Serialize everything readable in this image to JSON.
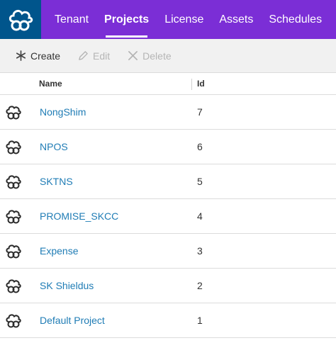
{
  "nav": {
    "logo_icon": "cloud-link-logo-icon",
    "tabs": [
      {
        "label": "Tenant",
        "active": false
      },
      {
        "label": "Projects",
        "active": true
      },
      {
        "label": "License",
        "active": false
      },
      {
        "label": "Assets",
        "active": false
      },
      {
        "label": "Schedules",
        "active": false
      }
    ],
    "colors": {
      "bar": "#7b2ed6",
      "logo_bg": "#00558c"
    }
  },
  "toolbar": {
    "create_label": "Create",
    "create_icon": "asterisk-icon",
    "edit_label": "Edit",
    "edit_icon": "pencil-icon",
    "delete_label": "Delete",
    "delete_icon": "x-icon"
  },
  "table": {
    "headers": {
      "name": "Name",
      "id": "Id"
    },
    "rows": [
      {
        "name": "NongShim",
        "id": "7"
      },
      {
        "name": "NPOS",
        "id": "6"
      },
      {
        "name": "SKTNS",
        "id": "5"
      },
      {
        "name": "PROMISE_SKCC",
        "id": "4"
      },
      {
        "name": "Expense",
        "id": "3"
      },
      {
        "name": "SK Shieldus",
        "id": "2"
      },
      {
        "name": "Default Project",
        "id": "1"
      }
    ],
    "row_icon": "project-cloud-icon",
    "link_color": "#1f7cb5"
  }
}
